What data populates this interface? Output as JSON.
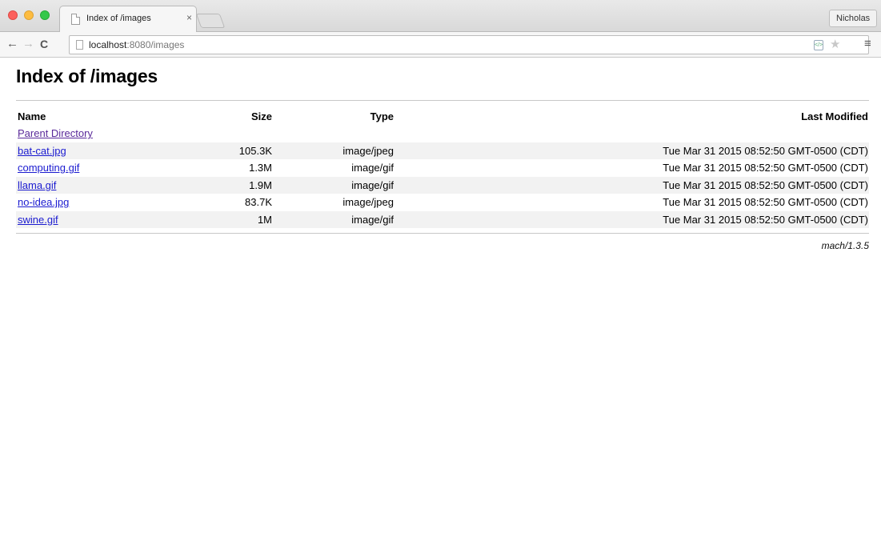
{
  "browser": {
    "tab_title": "Index of /images",
    "tab_close": "×",
    "profile_name": "Nicholas",
    "url_host": "localhost",
    "url_path": ":8080/images",
    "back_glyph": "←",
    "forward_glyph": "→",
    "reload_glyph": "C",
    "menu_glyph": "≡",
    "star_glyph": "★",
    "icons": [
      "page-icon",
      "back-arrow-icon",
      "forward-arrow-icon",
      "reload-icon",
      "extension-icon",
      "bookmark-star-icon",
      "hamburger-menu-icon",
      "close-icon"
    ]
  },
  "page": {
    "heading": "Index of /images",
    "columns": {
      "name": "Name",
      "size": "Size",
      "type": "Type",
      "modified": "Last Modified"
    },
    "parent_link": "Parent Directory",
    "files": [
      {
        "name": "bat-cat.jpg",
        "size": "105.3K",
        "type": "image/jpeg",
        "modified": "Tue Mar 31 2015 08:52:50 GMT-0500 (CDT)"
      },
      {
        "name": "computing.gif",
        "size": "1.3M",
        "type": "image/gif",
        "modified": "Tue Mar 31 2015 08:52:50 GMT-0500 (CDT)"
      },
      {
        "name": "llama.gif",
        "size": "1.9M",
        "type": "image/gif",
        "modified": "Tue Mar 31 2015 08:52:50 GMT-0500 (CDT)"
      },
      {
        "name": "no-idea.jpg",
        "size": "83.7K",
        "type": "image/jpeg",
        "modified": "Tue Mar 31 2015 08:52:50 GMT-0500 (CDT)"
      },
      {
        "name": "swine.gif",
        "size": "1M",
        "type": "image/gif",
        "modified": "Tue Mar 31 2015 08:52:50 GMT-0500 (CDT)"
      }
    ],
    "footer": "mach/1.3.5"
  },
  "colors": {
    "link": "#1b1bd0",
    "visited_link": "#5a2a9a",
    "row_stripe": "#f2f2f2"
  }
}
